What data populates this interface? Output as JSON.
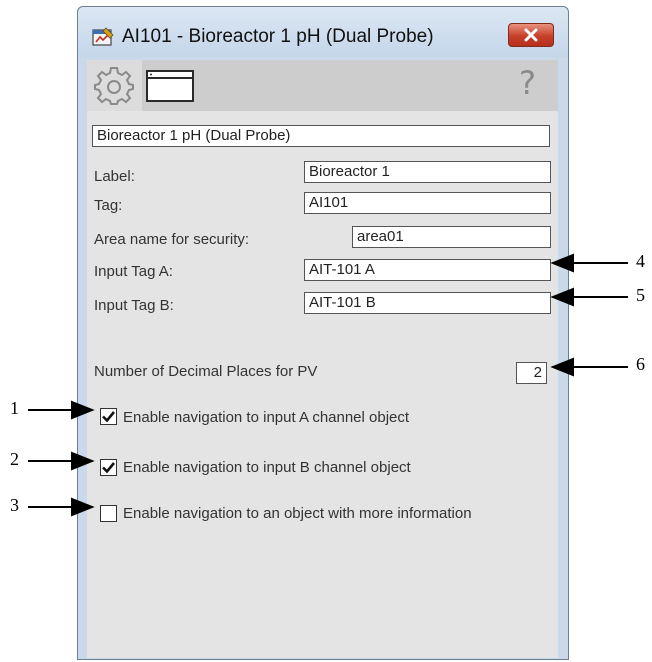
{
  "window": {
    "title": "AI101 - Bioreactor 1 pH (Dual Probe)",
    "accent": "#c9d9ea",
    "close_icon": "close-x-icon"
  },
  "toolbar": {
    "tabs": [
      {
        "icon": "gear-icon",
        "selected": true
      },
      {
        "icon": "window-icon",
        "selected": false
      }
    ],
    "help_label": "?"
  },
  "form": {
    "description": "Bioreactor 1 pH (Dual Probe)",
    "fields": [
      {
        "label": "Label:",
        "value": "Bioreactor 1"
      },
      {
        "label": "Tag:",
        "value": "AI101"
      },
      {
        "label": "Area name for security:",
        "value": "area01"
      },
      {
        "label": "Input Tag A:",
        "value": "AIT-101 A"
      },
      {
        "label": "Input Tag B:",
        "value": "AIT-101 B"
      }
    ],
    "decimal_label": "Number of Decimal Places for PV",
    "decimal_value": "2",
    "checkboxes": [
      {
        "label": "Enable navigation to input A channel object",
        "checked": true
      },
      {
        "label": "Enable navigation to input B channel object",
        "checked": true
      },
      {
        "label": "Enable navigation to an object with more information",
        "checked": false
      }
    ]
  },
  "callouts": [
    "1",
    "2",
    "3",
    "4",
    "5",
    "6"
  ]
}
